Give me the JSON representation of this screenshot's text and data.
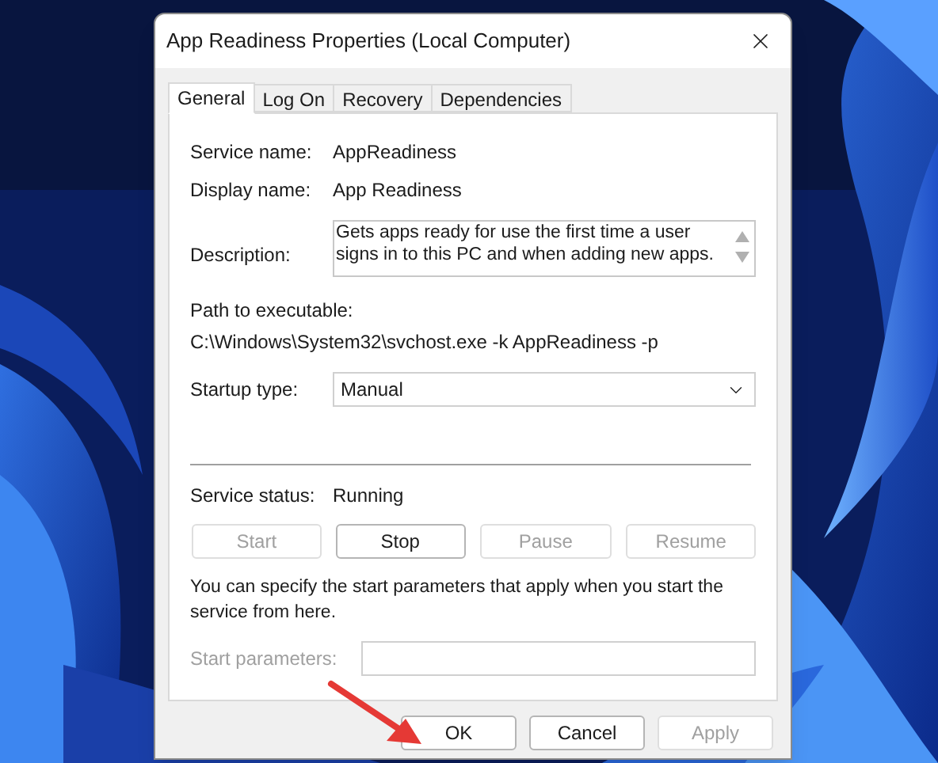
{
  "window": {
    "title": "App Readiness Properties (Local Computer)"
  },
  "tabs": [
    {
      "label": "General",
      "selected": true
    },
    {
      "label": "Log On",
      "selected": false
    },
    {
      "label": "Recovery",
      "selected": false
    },
    {
      "label": "Dependencies",
      "selected": false
    }
  ],
  "fields": [
    {
      "label": "Service name:",
      "value": "AppReadiness"
    },
    {
      "label": "Display name:",
      "value": "App Readiness"
    }
  ],
  "description": {
    "label": "Description:",
    "value": "Gets apps ready for use the first time a user signs in to this PC and when adding new apps."
  },
  "path": {
    "label": "Path to executable:",
    "value": "C:\\Windows\\System32\\svchost.exe -k AppReadiness -p"
  },
  "startup_type": {
    "label": "Startup type:",
    "value": "Manual"
  },
  "service_status": {
    "label": "Service status:",
    "value": "Running"
  },
  "service_buttons": [
    {
      "label": "Start",
      "disabled": true
    },
    {
      "label": "Stop",
      "disabled": false
    },
    {
      "label": "Pause",
      "disabled": true
    },
    {
      "label": "Resume",
      "disabled": true
    }
  ],
  "hint": "You can specify the start parameters that apply when you start the service from here.",
  "start_parameters": {
    "label": "Start parameters:",
    "disabled": true
  },
  "dialog_buttons": [
    {
      "label": "OK",
      "disabled": false
    },
    {
      "label": "Cancel",
      "disabled": false
    },
    {
      "label": "Apply",
      "disabled": true
    }
  ]
}
